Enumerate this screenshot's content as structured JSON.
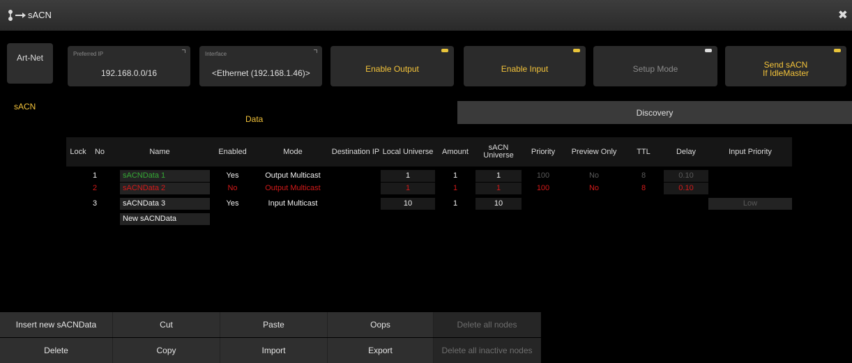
{
  "window": {
    "title": "sACN",
    "close_glyph": "✖"
  },
  "sidebar": {
    "tabs": [
      {
        "label": "Art-Net"
      },
      {
        "label": "sACN"
      }
    ]
  },
  "settings": {
    "preferred_ip": {
      "caption": "Preferred IP",
      "value": "192.168.0.0/16"
    },
    "interface": {
      "caption": "Interface",
      "value": "<Ethernet (192.168.1.46)>"
    },
    "enable_output": {
      "label": "Enable Output",
      "indicator": "#e8c43a"
    },
    "enable_input": {
      "label": "Enable Input",
      "indicator": "#e8c43a"
    },
    "setup_mode": {
      "label": "Setup Mode",
      "indicator": "#dddddd"
    },
    "send_sacn": {
      "label_line1": "Send sACN",
      "label_line2": "If IdleMaster",
      "indicator": "#e8c43a"
    }
  },
  "view_tabs": {
    "data": "Data",
    "discovery": "Discovery"
  },
  "table": {
    "headers": {
      "lock": "Lock",
      "no": "No",
      "name": "Name",
      "enabled": "Enabled",
      "mode": "Mode",
      "destination_ip": "Destination IP",
      "local_universe": "Local Universe",
      "amount": "Amount",
      "sacn_universe": "sACN Universe",
      "priority": "Priority",
      "preview_only": "Preview Only",
      "ttl": "TTL",
      "delay": "Delay",
      "input_priority": "Input Priority"
    },
    "rows": [
      {
        "no": "1",
        "name": "sACNData 1",
        "enabled": "Yes",
        "mode": "Output Multicast",
        "local_universe": "1",
        "amount": "1",
        "sacn_universe": "1",
        "priority": "100",
        "preview_only": "No",
        "ttl": "8",
        "delay": "0.10",
        "input_priority": ""
      },
      {
        "no": "2",
        "name": "sACNData 2",
        "enabled": "No",
        "mode": "Output Multicast",
        "local_universe": "1",
        "amount": "1",
        "sacn_universe": "1",
        "priority": "100",
        "preview_only": "No",
        "ttl": "8",
        "delay": "0.10",
        "input_priority": ""
      },
      {
        "no": "3",
        "name": "sACNData 3",
        "enabled": "Yes",
        "mode": "Input Multicast",
        "local_universe": "10",
        "amount": "1",
        "sacn_universe": "10",
        "priority": "",
        "preview_only": "",
        "ttl": "",
        "delay": "",
        "input_priority": "Low"
      }
    ],
    "new_row_label": "New sACNData"
  },
  "actions": {
    "insert": "Insert new sACNData",
    "cut": "Cut",
    "paste": "Paste",
    "oops": "Oops",
    "delete_all_nodes": "Delete all nodes",
    "delete": "Delete",
    "copy": "Copy",
    "import": "Import",
    "export": "Export",
    "delete_inactive": "Delete all inactive nodes"
  },
  "colors": {
    "accent_yellow": "#f3c33a",
    "row_green": "#35a935",
    "row_red": "#d51a1a"
  }
}
